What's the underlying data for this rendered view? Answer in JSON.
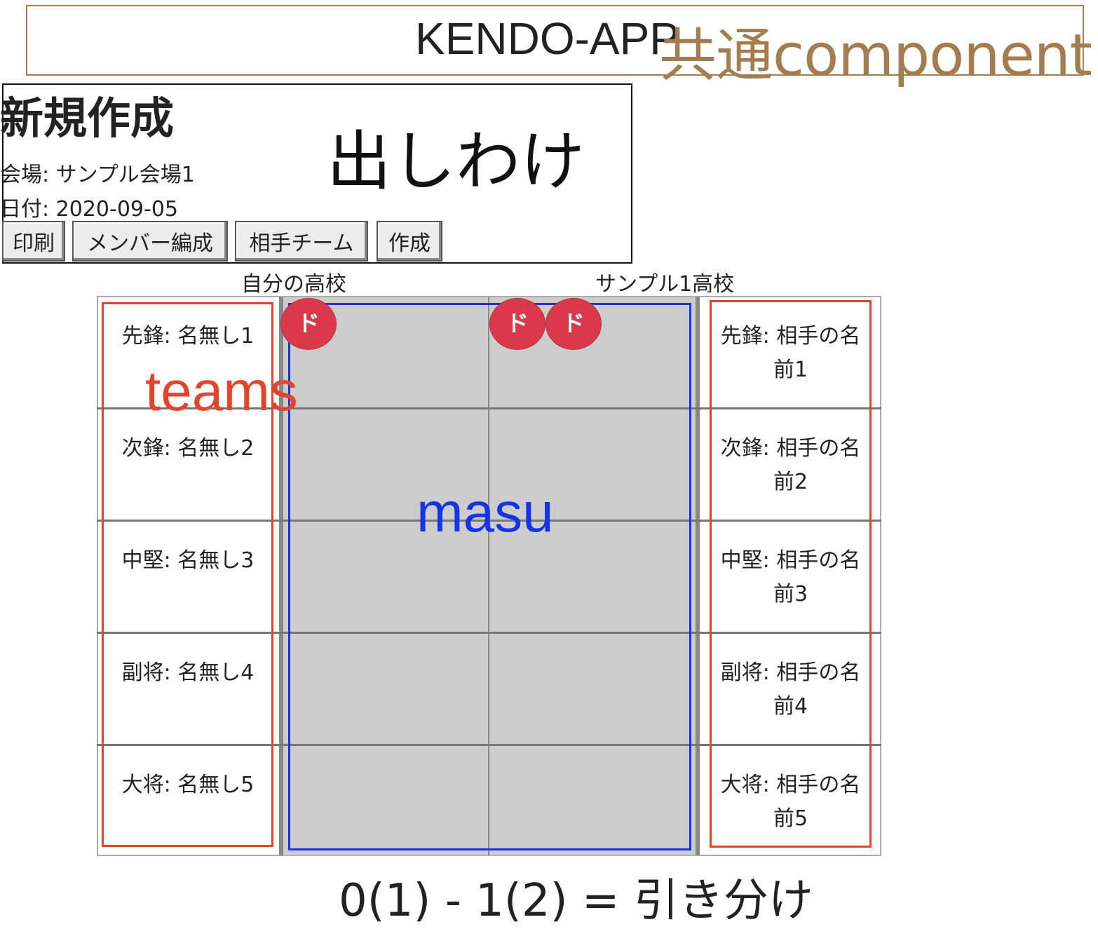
{
  "header": {
    "app_title": "KENDO-APP",
    "annotation": "共通component"
  },
  "panel": {
    "heading": "新規作成",
    "annotation": "出しわけ",
    "venue": "会場: サンプル会場1",
    "date": "日付: 2020-09-05",
    "buttons": {
      "print": "印刷",
      "members": "メンバー編成",
      "opponent": "相手チーム",
      "create": "作成"
    }
  },
  "teams": {
    "my_school": "自分の高校",
    "opponent_school": "サンプル1高校",
    "left": [
      "先鋒: 名無し1",
      "次鋒: 名無し2",
      "中堅: 名無し3",
      "副将: 名無し4",
      "大将: 名無し5"
    ],
    "right": [
      "先鋒: 相手の名前1",
      "次鋒: 相手の名前2",
      "中堅: 相手の名前3",
      "副将: 相手の名前4",
      "大将: 相手の名前5"
    ]
  },
  "annotations": {
    "teams": "teams",
    "masu": "masu"
  },
  "marks": [
    "ド",
    "ド",
    "ド"
  ],
  "colors": {
    "header_annotation": "#a37c4f",
    "teams_annotation": "#e2452e",
    "masu_annotation": "#1633e8",
    "mark": "#d9394a",
    "masu_background": "#cccccc"
  },
  "result": "0(1) - 1(2) = 引き分け"
}
